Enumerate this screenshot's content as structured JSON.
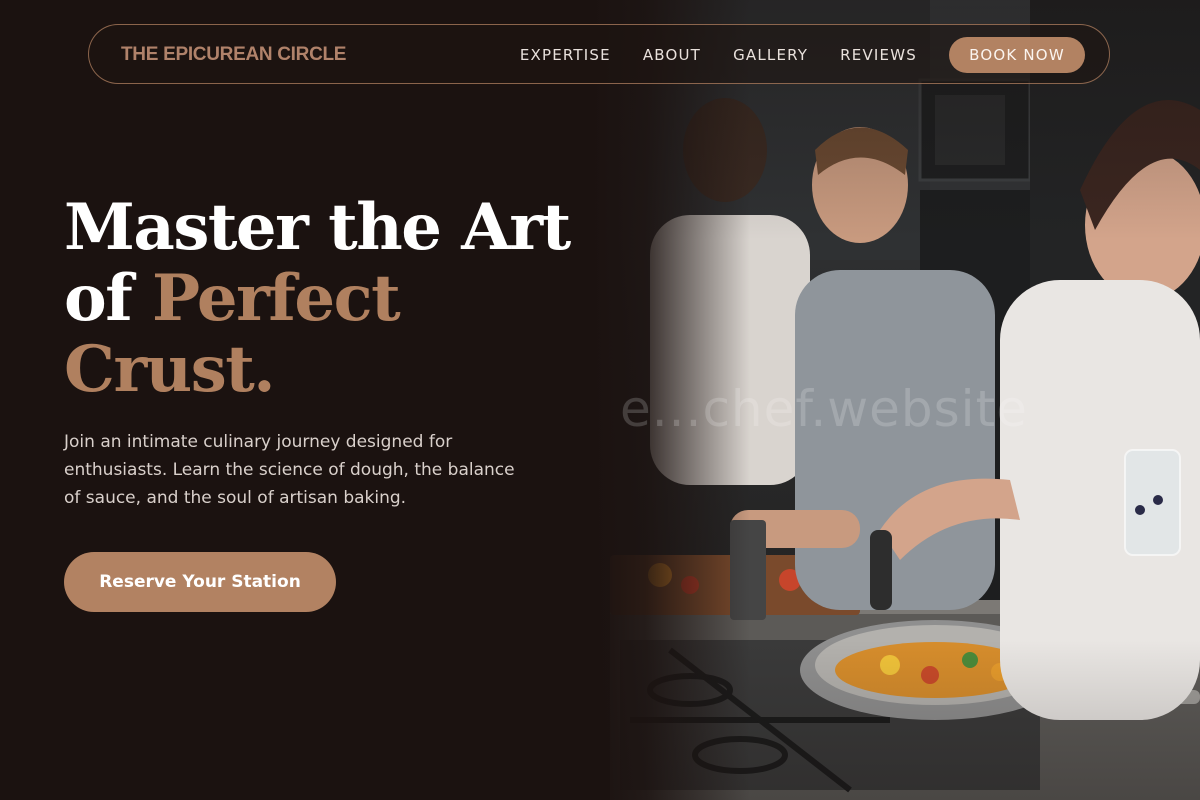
{
  "brand": {
    "name": "THE EPICUREAN CIRCLE"
  },
  "nav": {
    "links": [
      {
        "label": "EXPERTISE"
      },
      {
        "label": "ABOUT"
      },
      {
        "label": "GALLERY"
      },
      {
        "label": "REVIEWS"
      }
    ],
    "cta_label": "BOOK NOW"
  },
  "hero": {
    "headline_line1": "Master the Art",
    "headline_line2_prefix": "of ",
    "headline_line2_accent": "Perfect",
    "headline_line3_accent": "Crust.",
    "description": "Join an intimate culinary journey designed for enthusiasts. Learn the science of dough, the balance of sauce, and the soul of artisan baking.",
    "cta_label": "Reserve Your Station",
    "photo_watermark": "e...chef.website"
  },
  "colors": {
    "background": "#1b1210",
    "accent": "#b28262",
    "text": "#ffffff"
  }
}
